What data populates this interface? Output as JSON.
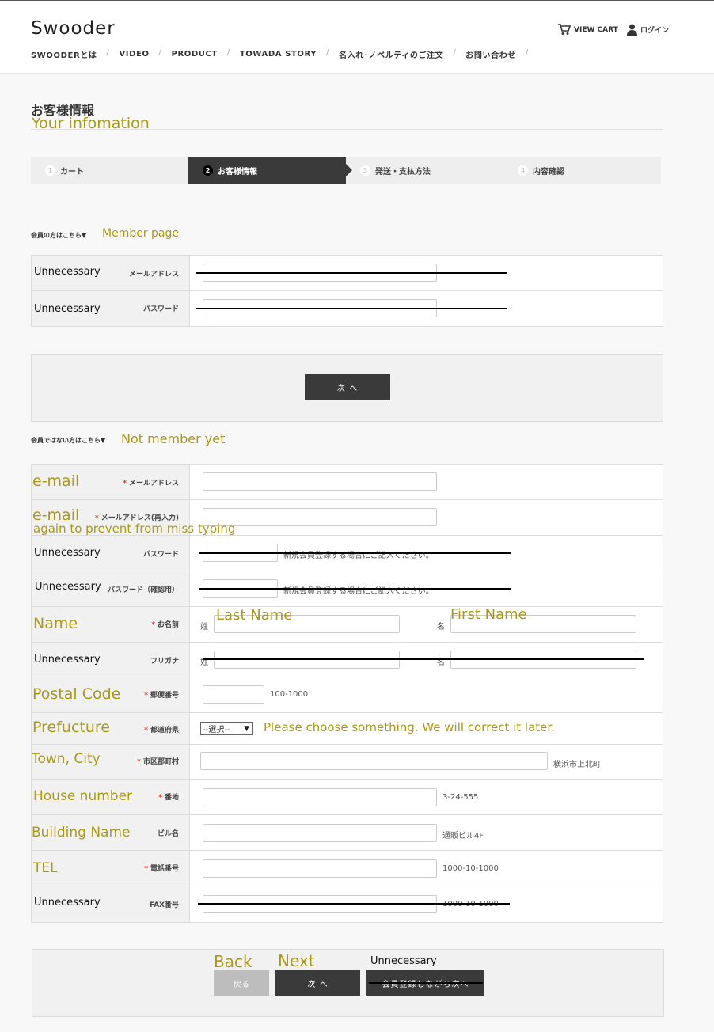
{
  "header": {
    "logo": "Swooder",
    "nav": [
      "SWOODERとは",
      "VIDEO",
      "PRODUCT",
      "TOWADA STORY",
      "名入れ･ノベルティのご注文",
      "お問い合わせ"
    ],
    "cart_label": "VIEW CART",
    "login_label": "ログイン"
  },
  "page": {
    "title_jp": "お客様情報",
    "title_en": "Your infomation"
  },
  "steps": [
    {
      "num": "1",
      "label": "カート"
    },
    {
      "num": "2",
      "label": "お客様情報"
    },
    {
      "num": "3",
      "label": "発送・支払方法"
    },
    {
      "num": "4",
      "label": "内容確認"
    }
  ],
  "member": {
    "label_jp": "会員の方はこちら▼",
    "label_en": "Member page",
    "rows": [
      {
        "annotation": "Unnecessary",
        "label": "メールアドレス"
      },
      {
        "annotation": "Unnecessary",
        "label": "パスワード"
      }
    ],
    "next_button": "次 へ"
  },
  "nonmember": {
    "label_jp": "会員ではない方はこちら▼",
    "label_en": "Not member yet",
    "rows": {
      "email": {
        "annotation": "e-mail",
        "label": "メールアドレス"
      },
      "email2": {
        "annotation": "e-mail",
        "annotation2": "again to prevent from miss typing",
        "label": "メールアドレス(再入力)"
      },
      "password": {
        "annotation": "Unnecessary",
        "label": "パスワード",
        "hint": "新規会員登録する場合にご記入ください。"
      },
      "password2": {
        "annotation": "Unnecessary",
        "label": "パスワード（確認用）",
        "hint": "新規会員登録する場合にご記入ください。"
      },
      "name": {
        "annotation": "Name",
        "label": "お名前",
        "sei": "姓",
        "mei": "名",
        "last_anno": "Last Name",
        "first_anno": "First Name"
      },
      "kana": {
        "annotation": "Unnecessary",
        "label": "フリガナ",
        "sei": "姓",
        "mei": "名"
      },
      "postal": {
        "annotation": "Postal Code",
        "label": "郵便番号",
        "hint": "100-1000"
      },
      "pref": {
        "annotation": "Prefucture",
        "label": "都道府県",
        "select": "--選択--",
        "note": "Please choose something. We will correct it later."
      },
      "city": {
        "annotation": "Town, City",
        "label": "市区郡町村",
        "hint": "横浜市上北町"
      },
      "house": {
        "annotation": "House number",
        "label": "番地",
        "hint": "3-24-555"
      },
      "building": {
        "annotation": "Building Name",
        "label": "ビル名",
        "hint": "通販ビル4F"
      },
      "tel": {
        "annotation": "TEL",
        "label": "電話番号",
        "hint": "1000-10-1000"
      },
      "fax": {
        "annotation": "Unnecessary",
        "label": "FAX番号",
        "hint": "1000-10-1000"
      }
    }
  },
  "footer": {
    "back_anno": "Back",
    "next_anno": "Next",
    "unnec_anno": "Unnecessary",
    "back_button": "戻る",
    "next_button": "次 へ",
    "register_button": "会員登録しながら次へ"
  }
}
